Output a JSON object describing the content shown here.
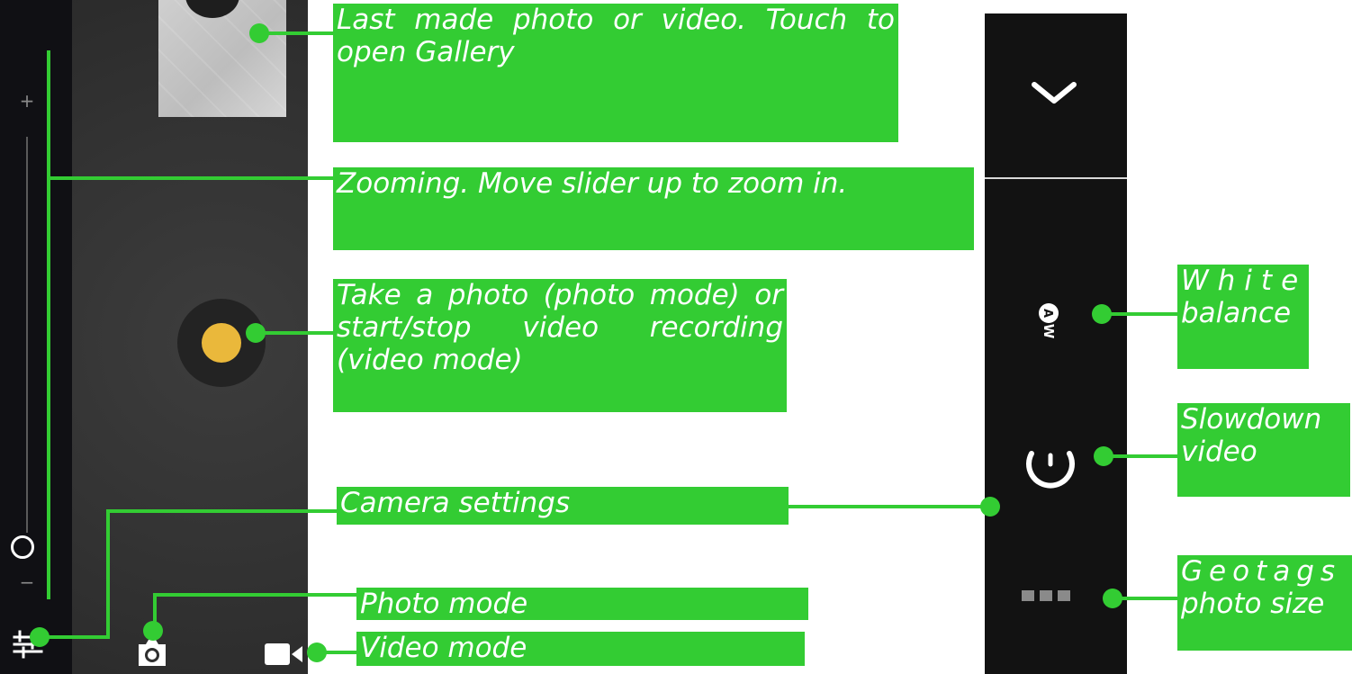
{
  "callouts": {
    "gallery": "Last made photo or video. Touch to open Gallery",
    "zoom": "Zooming. Move slider up to zoom in.",
    "shutter": "Take a photo (photo mode) or start/stop video recording (video mode)",
    "settings": "Camera settings",
    "photo_mode": "Photo mode",
    "video_mode": "Video mode",
    "white_balance": {
      "line1": "White",
      "line2": "balance"
    },
    "slowdown": {
      "line1": "Slowdown",
      "line2": "video"
    },
    "geotags": {
      "line1": "Geotags",
      "line2": "photo size"
    }
  },
  "camera_ui": {
    "zoom_plus": "+",
    "zoom_minus": "−",
    "zoom_level": 0,
    "white_balance_label": "AW"
  },
  "icons": {
    "zoom_knob": "circle-knob-icon",
    "shutter": "shutter-button-icon",
    "settings": "sliders-icon",
    "photo_mode": "camera-icon",
    "video_mode": "video-camera-icon",
    "collapse": "chevron-down-icon",
    "white_balance": "white-balance-auto-icon",
    "slowdown": "slow-motion-icon",
    "geotags": "three-squares-icon"
  },
  "colors": {
    "callout_green": "#33cc33",
    "shutter_yellow": "#eab83b",
    "panel_dark": "#121212",
    "text_white": "#ffffff"
  }
}
